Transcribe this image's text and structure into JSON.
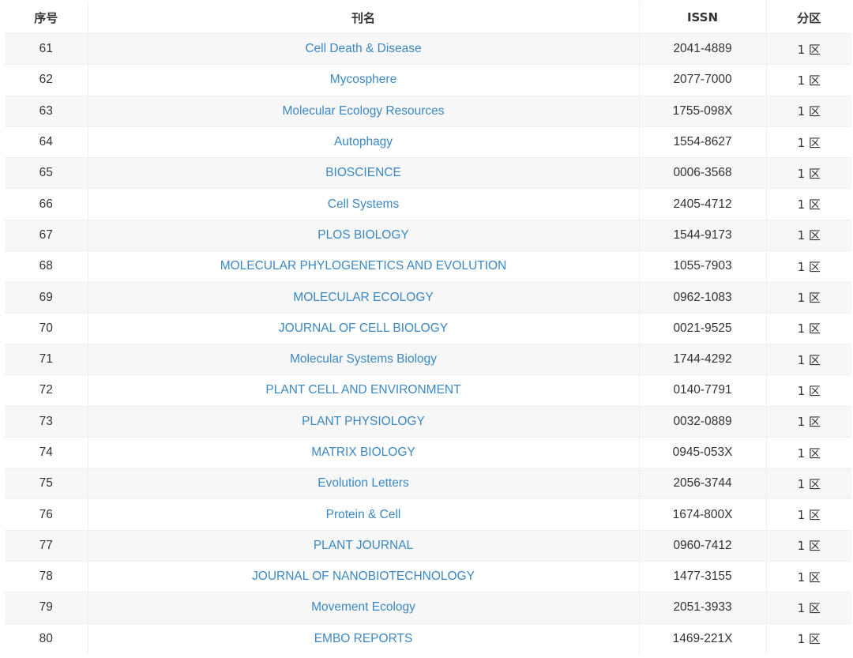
{
  "headers": {
    "index": "序号",
    "name": "刊名",
    "issn": "ISSN",
    "zone": "分区"
  },
  "rows": [
    {
      "index": "61",
      "name": "Cell Death & Disease",
      "issn": "2041-4889",
      "zone": "1 区"
    },
    {
      "index": "62",
      "name": "Mycosphere",
      "issn": "2077-7000",
      "zone": "1 区"
    },
    {
      "index": "63",
      "name": "Molecular Ecology Resources",
      "issn": "1755-098X",
      "zone": "1 区"
    },
    {
      "index": "64",
      "name": "Autophagy",
      "issn": "1554-8627",
      "zone": "1 区"
    },
    {
      "index": "65",
      "name": "BIOSCIENCE",
      "issn": "0006-3568",
      "zone": "1 区"
    },
    {
      "index": "66",
      "name": "Cell Systems",
      "issn": "2405-4712",
      "zone": "1 区"
    },
    {
      "index": "67",
      "name": "PLOS BIOLOGY",
      "issn": "1544-9173",
      "zone": "1 区"
    },
    {
      "index": "68",
      "name": "MOLECULAR PHYLOGENETICS AND EVOLUTION",
      "issn": "1055-7903",
      "zone": "1 区"
    },
    {
      "index": "69",
      "name": "MOLECULAR ECOLOGY",
      "issn": "0962-1083",
      "zone": "1 区"
    },
    {
      "index": "70",
      "name": "JOURNAL OF CELL BIOLOGY",
      "issn": "0021-9525",
      "zone": "1 区"
    },
    {
      "index": "71",
      "name": "Molecular Systems Biology",
      "issn": "1744-4292",
      "zone": "1 区"
    },
    {
      "index": "72",
      "name": "PLANT CELL AND ENVIRONMENT",
      "issn": "0140-7791",
      "zone": "1 区"
    },
    {
      "index": "73",
      "name": "PLANT PHYSIOLOGY",
      "issn": "0032-0889",
      "zone": "1 区"
    },
    {
      "index": "74",
      "name": "MATRIX BIOLOGY",
      "issn": "0945-053X",
      "zone": "1 区"
    },
    {
      "index": "75",
      "name": "Evolution Letters",
      "issn": "2056-3744",
      "zone": "1 区"
    },
    {
      "index": "76",
      "name": "Protein & Cell",
      "issn": "1674-800X",
      "zone": "1 区"
    },
    {
      "index": "77",
      "name": "PLANT JOURNAL",
      "issn": "0960-7412",
      "zone": "1 区"
    },
    {
      "index": "78",
      "name": "JOURNAL OF NANOBIOTECHNOLOGY",
      "issn": "1477-3155",
      "zone": "1 区"
    },
    {
      "index": "79",
      "name": "Movement Ecology",
      "issn": "2051-3933",
      "zone": "1 区"
    },
    {
      "index": "80",
      "name": "EMBO REPORTS",
      "issn": "1469-221X",
      "zone": "1 区"
    }
  ],
  "colors": {
    "link": "#3b88c3",
    "text": "#333333",
    "stripe": "#f7f7f7"
  }
}
